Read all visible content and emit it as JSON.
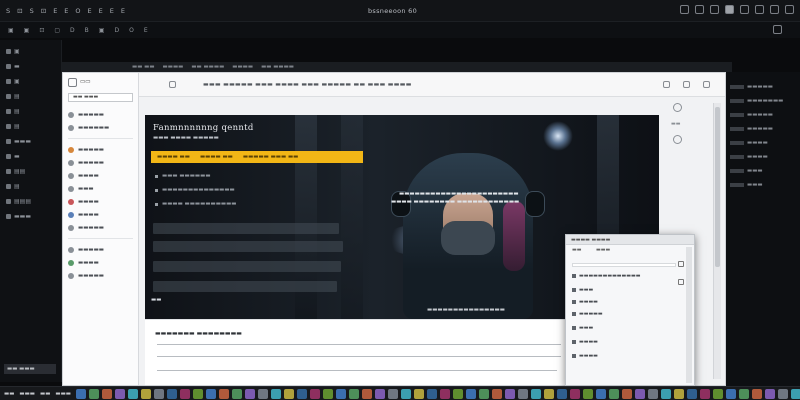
{
  "menubar": {
    "items": [
      "S",
      "⊡",
      "S",
      "⊡",
      "E",
      "E",
      "O",
      "E",
      "E",
      "E",
      "E"
    ],
    "window_title": "bssneeoon 60"
  },
  "toolbar2": {
    "tools": [
      "▣",
      "▣",
      "⊡",
      "▢",
      "D",
      "B",
      "▣",
      "D",
      "O",
      "E"
    ]
  },
  "left_panel": {
    "items": [
      "▣",
      "▬",
      "▣",
      "▤",
      "▤",
      "▤",
      "▬▬▬",
      "▬",
      "▤▤",
      "▤",
      "▤▤▤",
      "▬▬▬"
    ],
    "badge": "▬▬ ▬▬▬"
  },
  "strip_top": [
    "▬▬ ▬▬",
    "▬▬▬▬",
    "▬▬ ▬▬▬▬",
    "▬▬▬▬",
    "▬▬ ▬▬▬▬"
  ],
  "window": {
    "sidebar": {
      "header": "▭▭",
      "search_value": "▬▬ ▬▬▬",
      "items": [
        {
          "label": "▬▬▬▬▬",
          "icon": "circle-icon",
          "color": "gray"
        },
        {
          "label": "▬▬▬▬▬▬",
          "icon": "folder-icon",
          "color": "gray"
        },
        {
          "label": "▬▬▬▬▬",
          "icon": "star-icon",
          "color": "orange"
        },
        {
          "label": "▬▬▬▬▬",
          "icon": "circle-icon",
          "color": "gray"
        },
        {
          "label": "▬▬▬▬",
          "icon": "circle-icon",
          "color": "gray"
        },
        {
          "label": "▬▬▬",
          "icon": "gear-icon",
          "color": "gray"
        },
        {
          "label": "▬▬▬▬",
          "icon": "heart-icon",
          "color": "red"
        },
        {
          "label": "▬▬▬▬",
          "icon": "circle-icon",
          "color": "blue"
        },
        {
          "label": "▬▬▬▬▬",
          "icon": "circle-icon",
          "color": "gray"
        },
        {
          "label": "▬▬▬▬▬",
          "icon": "circle-icon",
          "color": "gray"
        },
        {
          "label": "▬▬▬▬",
          "icon": "circle-icon",
          "color": "green"
        },
        {
          "label": "▬▬▬▬▬",
          "icon": "circle-icon",
          "color": "gray"
        }
      ]
    },
    "toolbar_text": "▬▬▬ ▬▬▬▬▬ ▬▬▬ ▬▬▬▬ ▬▬▬ ▬▬▬▬▬ ▬▬ ▬▬▬ ▬▬▬▬"
  },
  "hero": {
    "title": "Fanmnnnnnng qenntd",
    "subtitle": "▬▬▬ ▬▬▬▬ ▬▬▬▬▬",
    "cta_items": [
      "▬▬▬▬ ▬▬",
      "▬▬▬▬ ▬▬",
      "▬▬▬▬▬ ▬▬▬ ▬▬"
    ],
    "bullets": [
      "▬▬▬ ▬▬▬▬▬▬",
      "▬▬▬▬▬▬▬▬▬▬▬▬▬▬",
      "▬▬▬▬ ▬▬▬▬▬▬▬▬▬▬"
    ],
    "overlay_lines": [
      "▬▬▬▬▬▬▬▬▬▬▬▬▬▬▬▬▬▬▬▬▬▬▬",
      "▬▬▬▬ ▬▬▬▬▬▬▬▬ ▬▬▬▬▬▬▬▬▬▬▬▬"
    ],
    "footer": "▬▬",
    "footer2": "▬▬▬▬▬▬▬▬▬▬▬▬▬▬▬"
  },
  "below": {
    "title": "▬▬▬▬▬▬▬ ▬▬▬▬▬▬▬▬"
  },
  "right_panel": {
    "items": [
      "▬▬▬▬▬",
      "▬▬▬▬▬▬▬",
      "▬▬▬▬▬",
      "▬▬▬▬▬",
      "▬▬▬▬",
      "▬▬▬▬",
      "▬▬▬",
      "▬▬▬"
    ]
  },
  "dialog": {
    "title": "▬▬▬▬ ▬▬▬▬",
    "tabs": [
      "▬▬",
      "▬▬▬"
    ],
    "rows": [
      "▬▬▬▬▬▬▬▬▬▬▬▬▬",
      "▬▬▬",
      "▬▬▬▬",
      "▬▬▬▬▬",
      "▬▬▬",
      "▬▬▬▬",
      "▬▬▬▬"
    ]
  },
  "dock": {
    "labels": [
      "▬▬",
      "▬▬▬",
      "▬▬",
      "▬▬▬"
    ],
    "colors": [
      "#3b6fb0",
      "#4d8f5a",
      "#b05a3b",
      "#7b5ab0",
      "#3b9fb0",
      "#b0a23b",
      "#6e7681",
      "#2f5f8e",
      "#8e2f5f",
      "#5f8e2f",
      "#3b6fb0",
      "#b05a3b",
      "#4d8f5a",
      "#7b5ab0",
      "#6e7681",
      "#3b9fb0",
      "#b0a23b",
      "#2f5f8e",
      "#8e2f5f",
      "#5f8e2f",
      "#3b6fb0",
      "#4d8f5a",
      "#b05a3b",
      "#7b5ab0",
      "#6e7681",
      "#3b9fb0",
      "#b0a23b",
      "#2f5f8e",
      "#8e2f5f",
      "#5f8e2f",
      "#3b6fb0",
      "#4d8f5a",
      "#b05a3b",
      "#7b5ab0",
      "#6e7681",
      "#3b9fb0",
      "#b0a23b",
      "#2f5f8e",
      "#8e2f5f",
      "#5f8e2f",
      "#3b6fb0",
      "#4d8f5a",
      "#b05a3b",
      "#7b5ab0",
      "#6e7681",
      "#3b9fb0",
      "#b0a23b",
      "#2f5f8e",
      "#8e2f5f",
      "#5f8e2f",
      "#3b6fb0",
      "#4d8f5a",
      "#b05a3b",
      "#7b5ab0",
      "#6e7681",
      "#3b9fb0",
      "#b0a23b",
      "#2f5f8e"
    ]
  },
  "colors": {
    "accent_yellow": "#f2b616",
    "bg_dark": "#0a0b0d",
    "window_bg": "#f1f2f4"
  }
}
